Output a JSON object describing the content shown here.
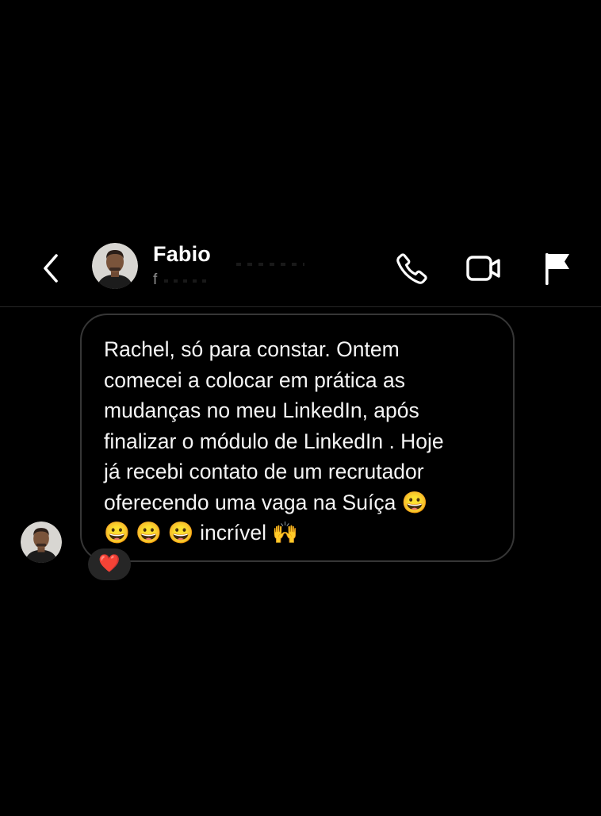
{
  "header": {
    "contact_name": "Fabio",
    "contact_sub": "f",
    "back_icon": "chevron-left-icon",
    "actions": [
      {
        "name": "call",
        "icon": "phone-icon"
      },
      {
        "name": "video",
        "icon": "video-camera-icon"
      },
      {
        "name": "report",
        "icon": "flag-icon"
      }
    ]
  },
  "conversation": {
    "messages": [
      {
        "sender": "Fabio",
        "text": "Rachel, só para constar. Ontem\ncomecei a colocar em prática as\nmudanças no meu LinkedIn, após\nfinalizar o módulo de LinkedIn . Hoje\njá recebi contato de um recrutador\noferecendo uma vaga na Suíça 😀\n😀 😀 😀  incrível 🙌",
        "reaction": "❤️"
      }
    ]
  },
  "colors": {
    "background": "#000000",
    "bubble_border": "#363636",
    "divider": "#262626",
    "reaction_bg": "#262626",
    "text": "#f5f5f5",
    "subtext": "#8e8e8e",
    "heart": "#ed4956"
  }
}
